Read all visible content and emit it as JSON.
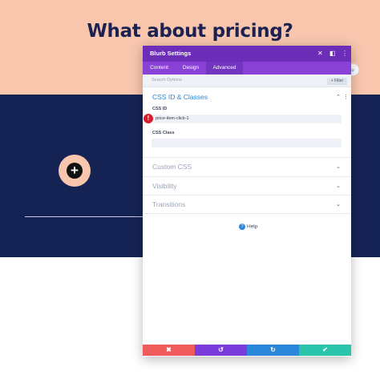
{
  "hero": {
    "title": "What about pricing?"
  },
  "modal": {
    "title": "Blurb Settings",
    "header_icons": {
      "close": "✕",
      "expand": "◧",
      "more": "⋮"
    },
    "tabs": [
      {
        "label": "Content",
        "active": false
      },
      {
        "label": "Design",
        "active": false
      },
      {
        "label": "Advanced",
        "active": true
      }
    ],
    "search": {
      "placeholder": "Search Options",
      "filter_label": "+ Filter"
    },
    "open_group": {
      "title": "CSS ID & Classes",
      "fields": [
        {
          "label": "CSS ID",
          "value": "price-item-click-1"
        },
        {
          "label": "CSS Class",
          "value": ""
        }
      ]
    },
    "error_badge": "!",
    "closed_groups": [
      "Custom CSS",
      "Visibility",
      "Transitions"
    ],
    "help": "Help",
    "footer_icons": {
      "discard": "✖",
      "undo": "↺",
      "redo": "↻",
      "save": "✔"
    }
  },
  "colors": {
    "hero_bg": "#f8c6ad",
    "navy_bg": "#152254",
    "modal_header": "#6c2eb9",
    "accent_blue": "#2b87da",
    "discard": "#ef5a5a",
    "undo": "#7b3cdc",
    "redo": "#2b87da",
    "save": "#29c4a9"
  }
}
